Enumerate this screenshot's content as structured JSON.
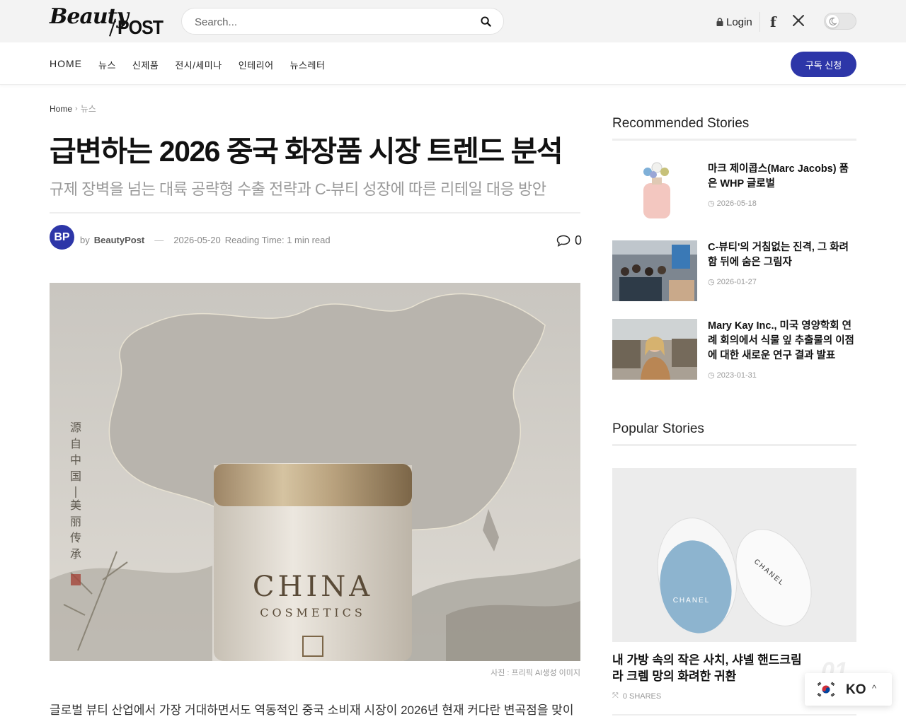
{
  "header": {
    "logo_script": "Beauty",
    "logo_post": "POST",
    "search_placeholder": "Search...",
    "login_label": "Login",
    "facebook_glyph": "f"
  },
  "nav": {
    "items": [
      "HOME",
      "뉴스",
      "신제품",
      "전시/세미나",
      "인테리어",
      "뉴스레터"
    ],
    "subscribe_label": "구독 신청"
  },
  "breadcrumb": {
    "home": "Home",
    "current": "뉴스"
  },
  "article": {
    "title": "급변하는 2026 중국 화장품 시장 트렌드 분석",
    "subtitle": "규제 장벽을 넘는 대륙 공략형 수출 전략과 C-뷰티 성장에 따른 리테일 대응 방안",
    "avatar_initials": "BP",
    "by": "by",
    "author": "BeautyPost",
    "date": "2026-05-20",
    "reading_time": "Reading Time: 1 min read",
    "comment_count": "0",
    "hero_brand": "CHINA",
    "hero_sub": "COSMETICS",
    "hero_vertical": [
      "源",
      "自",
      "中",
      "国",
      "-",
      "美",
      "丽",
      "传",
      "承"
    ],
    "caption": "사진 : 프리픽 AI생성 이미지",
    "body_lines": [
      "글로벌 뷰티 산업에서 가장 거대하면서도 역동적인 중국 소비재 시장이 2026년 현재 커다란 변곡점을 맞이하고 있습니"
    ]
  },
  "sidebar": {
    "recommended_heading": "Recommended Stories",
    "recommended": [
      {
        "title": "마크 제이콥스(Marc Jacobs) 품은 WHP 글로벌",
        "date": "2026-05-18"
      },
      {
        "title": "C-뷰티'의 거침없는 진격, 그 화려함 뒤에 숨은 그림자",
        "date": "2026-01-27"
      },
      {
        "title": "Mary Kay Inc., 미국 영양학회 연례 회의에서 식물 잎 추출물의 이점에 대한 새로운 연구 결과 발표",
        "date": "2023-01-31"
      }
    ],
    "popular_heading": "Popular Stories",
    "popular": {
      "title": "내 가방 속의 작은 사치, 샤넬 핸드크림 라 크렘 망의 화려한 귀환",
      "shares": "0 SHARES",
      "rank": "01",
      "img_text_1": "CHANEL",
      "img_text_2": "CHANEL"
    }
  },
  "language": {
    "code": "KO",
    "caret": "^"
  },
  "colors": {
    "brand": "#2d36a8"
  }
}
